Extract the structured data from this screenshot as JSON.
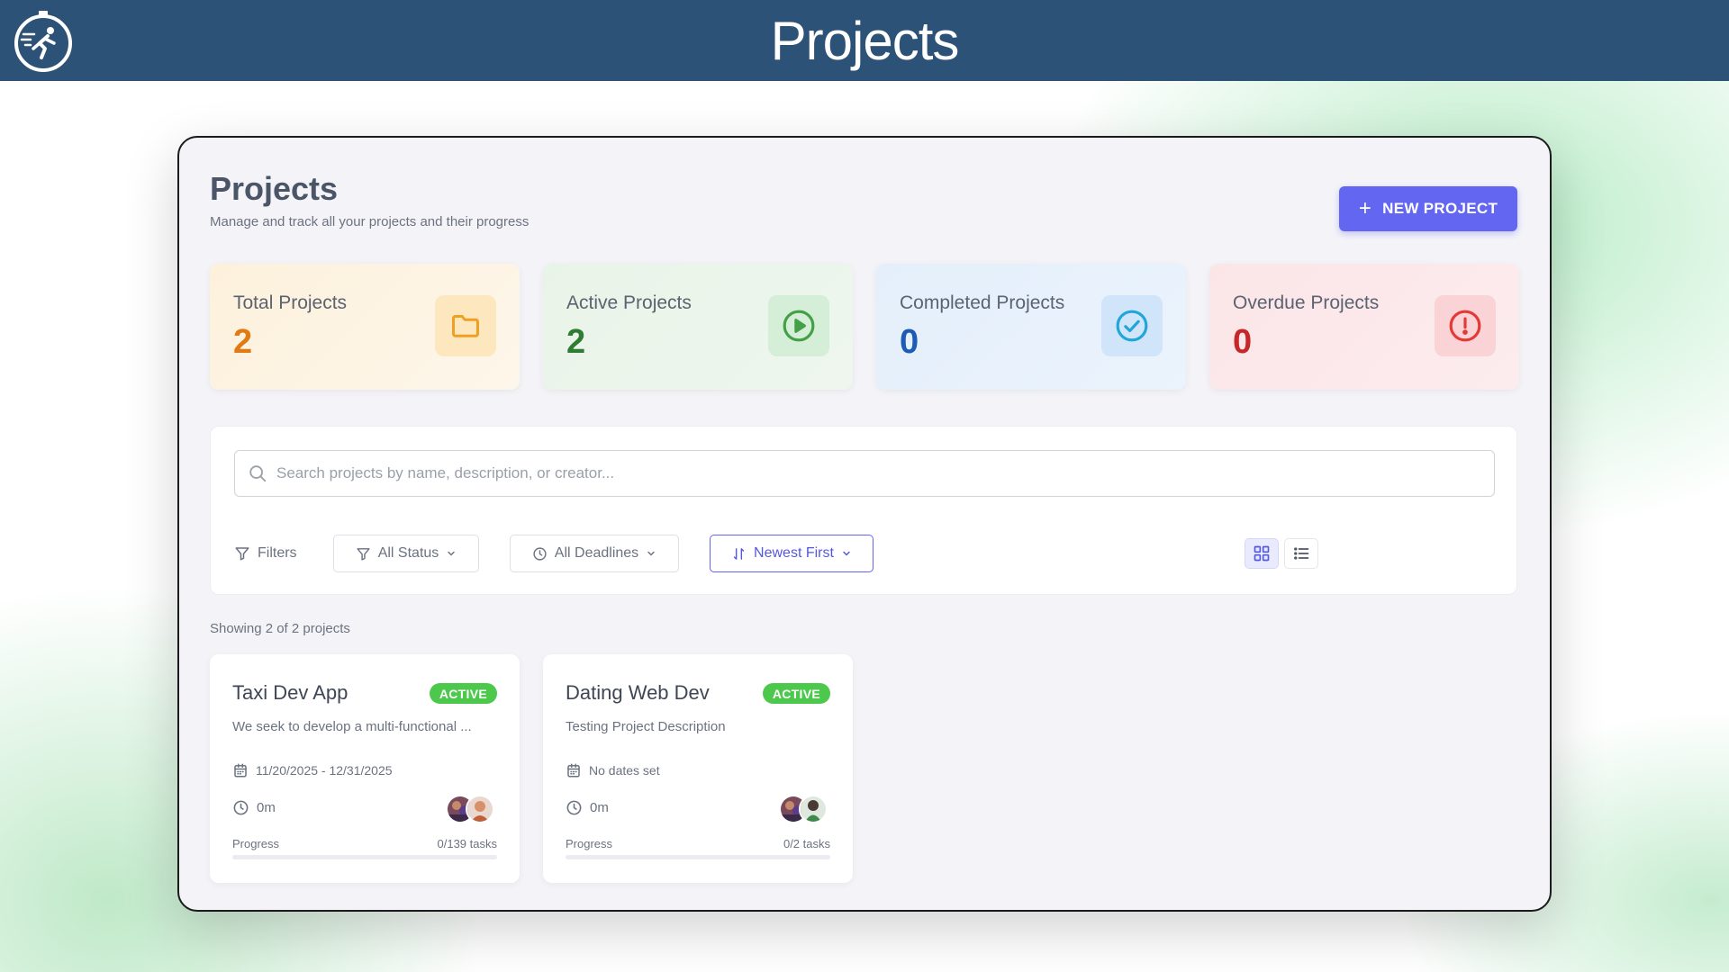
{
  "header": {
    "title": "Projects",
    "logo_icon": "runner-stopwatch-icon"
  },
  "page": {
    "title": "Projects",
    "subtitle": "Manage and track all your projects and their progress",
    "new_project_label": "NEW PROJECT"
  },
  "stats": [
    {
      "label": "Total Projects",
      "value": "2",
      "icon": "folder-icon",
      "color": "#e07a12"
    },
    {
      "label": "Active Projects",
      "value": "2",
      "icon": "play-circle-icon",
      "color": "#2e7d32"
    },
    {
      "label": "Completed Projects",
      "value": "0",
      "icon": "check-circle-icon",
      "color": "#1e5bb5"
    },
    {
      "label": "Overdue Projects",
      "value": "0",
      "icon": "alert-circle-icon",
      "color": "#c62828"
    }
  ],
  "search": {
    "placeholder": "Search projects by name, description, or creator...",
    "value": ""
  },
  "filters": {
    "label": "Filters",
    "status": "All Status",
    "deadline": "All Deadlines",
    "sort": "Newest First",
    "view_mode": "grid"
  },
  "results": {
    "showing": "Showing 2 of 2 projects"
  },
  "projects": [
    {
      "name": "Taxi Dev App",
      "status": "ACTIVE",
      "description": "We seek to develop a multi-functional ...",
      "dates": "11/20/2025 - 12/31/2025",
      "time": "0m",
      "progress_label": "Progress",
      "tasks": "0/139 tasks",
      "progress": 0
    },
    {
      "name": "Dating Web Dev",
      "status": "ACTIVE",
      "description": "Testing Project Description",
      "dates": "No dates set",
      "time": "0m",
      "progress_label": "Progress",
      "tasks": "0/2 tasks",
      "progress": 0
    }
  ],
  "colors": {
    "header_bg": "#2c5278",
    "accent": "#6366f1",
    "active_badge": "#4cc94c"
  }
}
